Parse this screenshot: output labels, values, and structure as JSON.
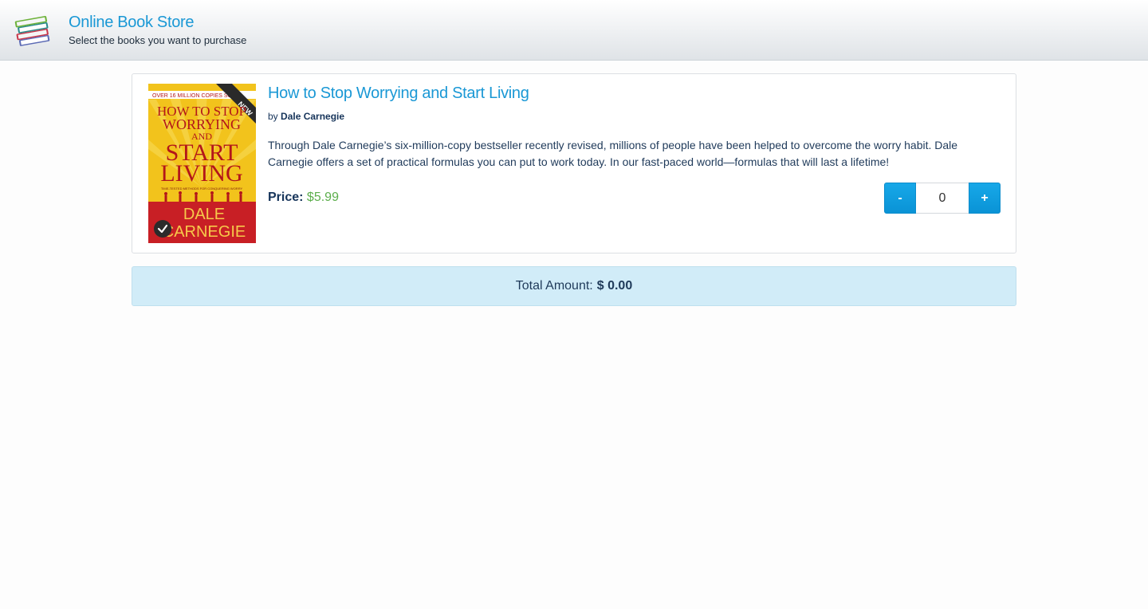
{
  "header": {
    "title": "Online Book Store",
    "subtitle": "Select the books you want to purchase"
  },
  "books": [
    {
      "title": "How to Stop Worrying and Start Living",
      "author_prefix": "by",
      "author": "Dale Carnegie",
      "description": "Through Dale Carnegie’s six-million-copy bestseller recently revised, millions of people have been helped to overcome the worry habit. Dale Carnegie offers a set of practical formulas you can put to work today. In our fast-paced world—formulas that will last a lifetime!",
      "price_label": "Price:",
      "price": "$5.99",
      "quantity": "0",
      "decrement_label": "-",
      "increment_label": "+",
      "cover": {
        "top_banner": "OVER 16 MILLION COPIES SOLD",
        "ribbon": "NEW",
        "title_lines": [
          "HOW TO STOP",
          "WORRYING",
          "AND",
          "START",
          "LIVING"
        ],
        "tagline": "TIME-TESTED METHODS FOR CONQUERING WORRY",
        "author_lines": [
          "DALE",
          "CARNEGIE"
        ],
        "colors": {
          "background": "#f2c31c",
          "title": "#b3161a",
          "bottom": "#c81f25"
        }
      }
    }
  ],
  "total": {
    "label": "Total Amount:",
    "value": "$ 0.00"
  },
  "colors": {
    "accent": "#1a98d5",
    "price": "#5cae4c",
    "total_background": "#d1ecf8"
  }
}
